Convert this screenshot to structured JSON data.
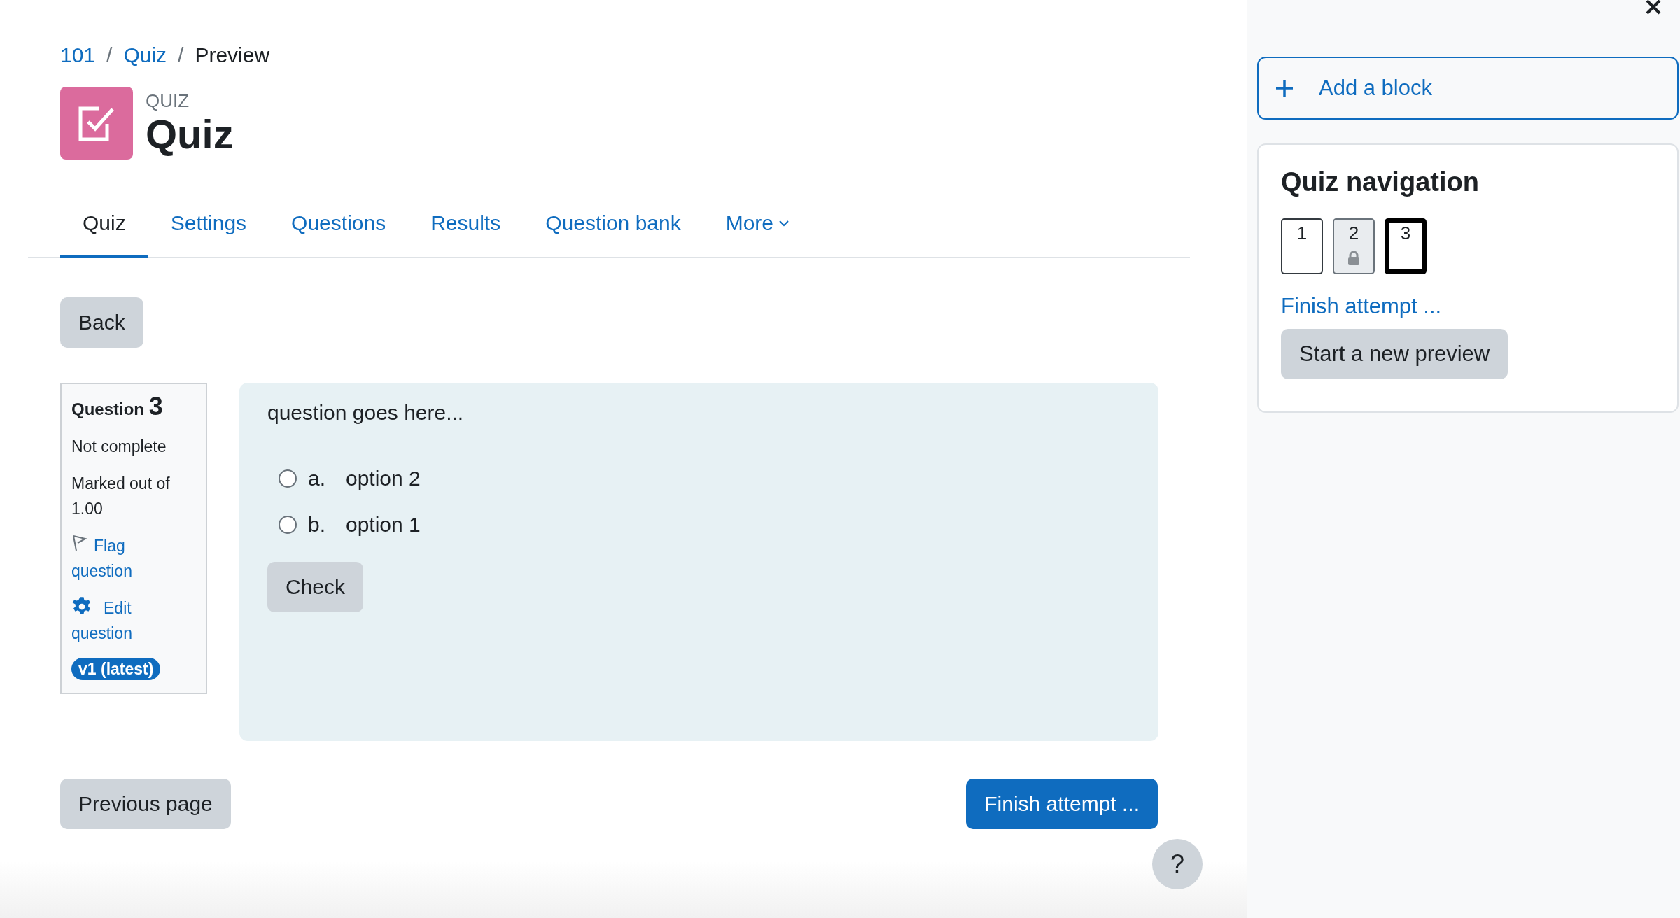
{
  "breadcrumb": [
    {
      "kind": "link",
      "label": "101"
    },
    {
      "kind": "separator",
      "label": "/"
    },
    {
      "kind": "link",
      "label": "Quiz"
    },
    {
      "kind": "separator",
      "label": "/"
    },
    {
      "kind": "current",
      "label": "Preview"
    }
  ],
  "header": {
    "eyebrow": "QUIZ",
    "title": "Quiz"
  },
  "tabs": [
    {
      "label": "Quiz",
      "selected": true
    },
    {
      "label": "Settings",
      "selected": false
    },
    {
      "label": "Questions",
      "selected": false
    },
    {
      "label": "Results",
      "selected": false
    },
    {
      "label": "Question bank",
      "selected": false
    },
    {
      "label": "More",
      "selected": false,
      "dropdown": true
    }
  ],
  "back_button": "Back",
  "question_info": {
    "label": "Question",
    "number": "3",
    "status": "Not complete",
    "marks": "Marked out of 1.00",
    "flag": "Flag question",
    "edit": "Edit question",
    "version": "v1 (latest)"
  },
  "question": {
    "text": "question goes here...",
    "options": [
      {
        "letter": "a.",
        "text": "option 2",
        "selected": false
      },
      {
        "letter": "b.",
        "text": "option 1",
        "selected": false
      }
    ],
    "check_button": "Check"
  },
  "footer": {
    "previous": "Previous page",
    "finish": "Finish attempt ...",
    "help": "?"
  },
  "drawer": {
    "add_block": "Add a block",
    "navigation": {
      "title": "Quiz navigation",
      "questions": [
        {
          "label": "1",
          "selected": false,
          "locked": false
        },
        {
          "label": "2",
          "selected": false,
          "locked": true
        },
        {
          "label": "3",
          "selected": true,
          "locked": false
        }
      ],
      "finish_link": "Finish attempt ...",
      "new_preview": "Start a new preview"
    }
  }
}
